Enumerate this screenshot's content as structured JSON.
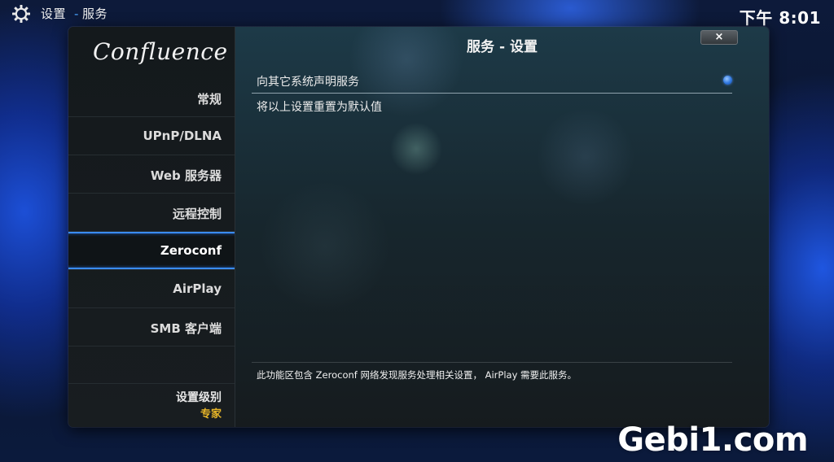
{
  "topbar": {
    "breadcrumb_root": "设置",
    "breadcrumb_sep": "-",
    "breadcrumb_current": "服务",
    "clock": "下午 8:01",
    "icon": "gear-icon"
  },
  "sidebar": {
    "logo": "Confluence",
    "items": [
      {
        "label": "常规",
        "active": false
      },
      {
        "label": "UPnP/DLNA",
        "active": false
      },
      {
        "label": "Web 服务器",
        "active": false
      },
      {
        "label": "远程控制",
        "active": false
      },
      {
        "label": "Zeroconf",
        "active": true
      },
      {
        "label": "AirPlay",
        "active": false
      },
      {
        "label": "SMB 客户端",
        "active": false
      }
    ],
    "level_title": "设置级别",
    "level_value": "专家"
  },
  "content": {
    "title": "服务 - 设置",
    "close_label": "×",
    "settings": [
      {
        "label": "向其它系统声明服务",
        "type": "radio",
        "checked": true
      },
      {
        "label": "将以上设置重置为默认值",
        "type": "action"
      }
    ],
    "help": "此功能区包含 Zeroconf 网络发现服务处理相关设置， AirPlay 需要此服务。"
  },
  "watermark": "Gebi1.com",
  "colors": {
    "accent": "#3a8cff",
    "level_value": "#e8b628",
    "panel_bg": "#1a2024"
  }
}
